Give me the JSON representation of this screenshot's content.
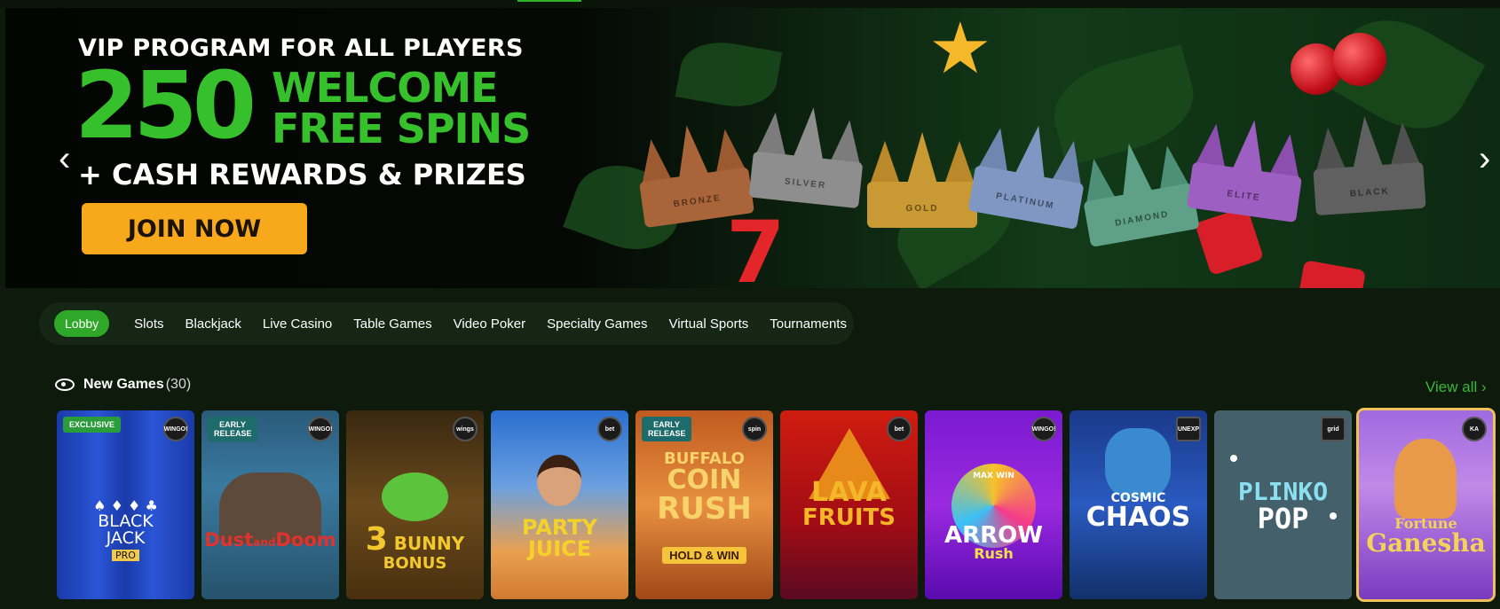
{
  "colors": {
    "accent": "#2fb52a",
    "promo_green": "#36c12c",
    "cta": "#f7a81b",
    "link": "#3cb837"
  },
  "banner": {
    "line1": "VIP PROGRAM FOR ALL PLAYERS",
    "big_number": "250",
    "welcome_line1": "WELCOME",
    "welcome_line2": "FREE SPINS",
    "line3": "+ CASH REWARDS & PRIZES",
    "cta_label": "JOIN NOW",
    "prev_icon": "chevron-left-icon",
    "next_icon": "chevron-right-icon",
    "crown_labels": [
      "BRONZE",
      "SILVER",
      "GOLD",
      "PLATINUM",
      "DIAMOND",
      "ELITE",
      "BLACK"
    ]
  },
  "nav": {
    "active": "Lobby",
    "items": [
      "Slots",
      "Blackjack",
      "Live Casino",
      "Table Games",
      "Video Poker",
      "Specialty Games",
      "Virtual Sports",
      "Tournaments"
    ]
  },
  "new_games": {
    "icon": "eye-icon",
    "title": "New Games",
    "count": "(30)",
    "view_all": "View all",
    "items": [
      {
        "title": "BLACK",
        "title2": "JACK",
        "tag": "PRO",
        "badge": "EXCLUSIVE",
        "provider": "WINGO!"
      },
      {
        "title": "Dust",
        "title2": "and",
        "title3": "Doom",
        "badge": "EARLY RELEASE",
        "provider": "WINGO!"
      },
      {
        "title": "3",
        "title2": "BUNNY",
        "title3": "BONUS",
        "badge": "",
        "provider": "wings"
      },
      {
        "title": "PARTY",
        "title2": "JUICE",
        "badge": "",
        "provider": "bet"
      },
      {
        "title": "BUFFALO",
        "title2": "COIN",
        "title3": "RUSH",
        "sub": "HOLD & WIN",
        "badge": "EARLY RELEASE",
        "provider": "spin"
      },
      {
        "title": "LAVA",
        "title2": "FRUITS",
        "badge": "",
        "provider": "bet"
      },
      {
        "title": "MAX WIN",
        "title2": "ARROW",
        "title3": "Rush",
        "badge": "",
        "provider": "WINGO!"
      },
      {
        "title": "COSMIC",
        "title2": "CHAOS",
        "badge": "",
        "provider": "UNEXP"
      },
      {
        "title": "PLINKO",
        "title2": "POP",
        "badge": "",
        "provider": "grid"
      },
      {
        "title": "Fortune",
        "title2": "Ganesha",
        "badge": "",
        "provider": "KA"
      }
    ]
  }
}
